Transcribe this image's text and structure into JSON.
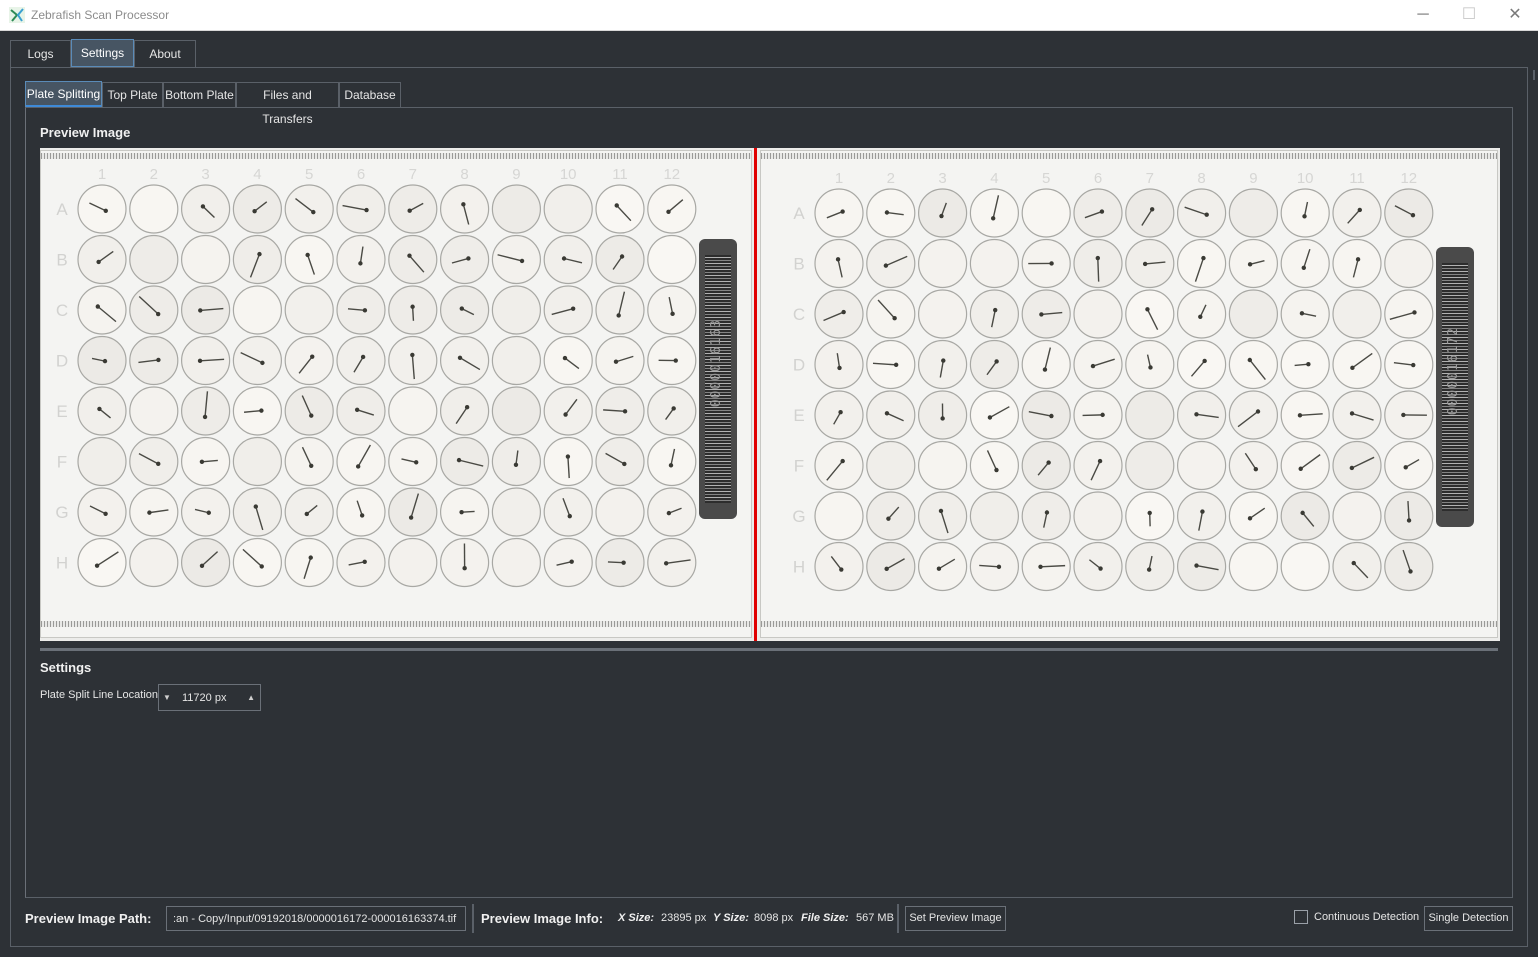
{
  "window": {
    "title": "Zebrafish Scan Processor",
    "minimize": "─",
    "maximize": "☐",
    "close": "✕"
  },
  "main_tabs": [
    {
      "label": "Logs"
    },
    {
      "label": "Settings"
    },
    {
      "label": "About"
    }
  ],
  "active_main_tab": "Settings",
  "sub_tabs": [
    {
      "label": "Plate Splitting"
    },
    {
      "label": "Top Plate"
    },
    {
      "label": "Bottom Plate"
    },
    {
      "label": "Files and Transfers"
    },
    {
      "label": "Database"
    }
  ],
  "active_sub_tab": "Plate Splitting",
  "preview": {
    "heading": "Preview Image",
    "plate_rows": [
      "A",
      "B",
      "C",
      "D",
      "E",
      "F",
      "G",
      "H"
    ],
    "plate_columns": [
      "1",
      "2",
      "3",
      "4",
      "5",
      "6",
      "7",
      "8",
      "9",
      "10",
      "11",
      "12"
    ],
    "left_barcode": "0000016163",
    "right_barcode": "0000016172",
    "split_line_color": "#e00000"
  },
  "settings": {
    "heading": "Settings",
    "split_line_label": "Plate Split Line Location",
    "split_line_value": "11720 px"
  },
  "bottom_bar": {
    "path_label": "Preview Image Path:",
    "path_value": ":an - Copy/Input/09192018/0000016172-000016163374.tif",
    "info_label": "Preview Image Info:",
    "x_size_label": "X Size:",
    "x_size_value": "23895 px",
    "y_size_label": "Y Size:",
    "y_size_value": "8098 px",
    "file_size_label": "File Size:",
    "file_size_value": "567 MB",
    "set_preview_button": "Set Preview Image",
    "continuous_detection_label": "Continuous Detection",
    "continuous_detection_checked": false,
    "single_detection_button": "Single Detection"
  },
  "colors": {
    "background": "#2d3136",
    "active_tab": "#475563",
    "accent": "#3e8ad8",
    "split_line": "#e00000"
  }
}
